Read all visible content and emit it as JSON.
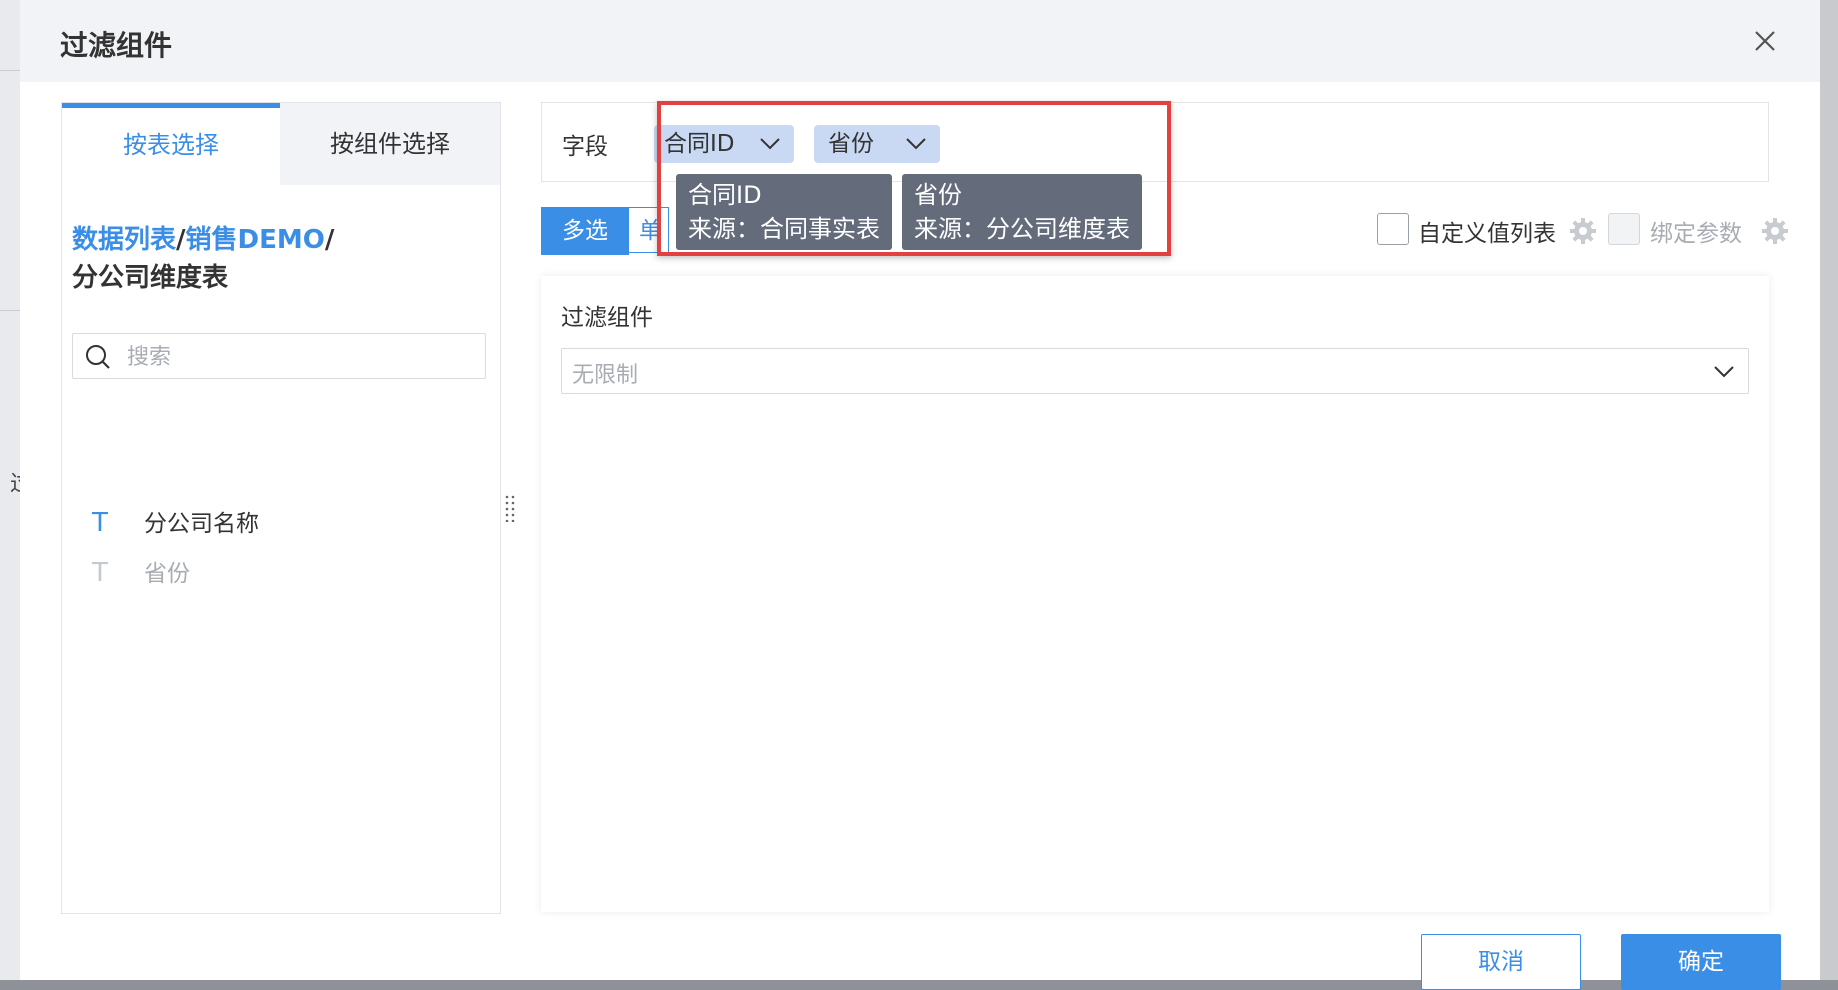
{
  "dialog": {
    "title": "过滤组件"
  },
  "left_panel": {
    "tabs": [
      {
        "label": "按表选择",
        "active": true
      },
      {
        "label": "按组件选择",
        "active": false
      }
    ],
    "breadcrumb": {
      "links": [
        "数据列表",
        "销售DEMO"
      ],
      "separator": "/",
      "current": "分公司维度表"
    },
    "search": {
      "placeholder": "搜索"
    },
    "fields": [
      {
        "type_icon": "T",
        "label": "分公司名称",
        "enabled": true
      },
      {
        "type_icon": "T",
        "label": "省份",
        "enabled": false
      }
    ]
  },
  "field_row": {
    "label": "字段",
    "tags": [
      {
        "label": "合同ID"
      },
      {
        "label": "省份"
      }
    ],
    "tooltips": [
      {
        "name": "合同ID",
        "source": "来源：合同事实表"
      },
      {
        "name": "省份",
        "source": "来源：分公司维度表"
      }
    ]
  },
  "mode": {
    "active": "多选",
    "inactive": "单"
  },
  "options": {
    "custom_value_list": "自定义值列表",
    "bind_params": "绑定参数"
  },
  "config": {
    "title": "过滤组件",
    "select_value": "无限制"
  },
  "footer": {
    "cancel": "取消",
    "ok": "确定"
  },
  "background": {
    "partial_text": "过"
  },
  "colors": {
    "accent": "#3a8ee6",
    "highlight": "#e34040",
    "tooltip_bg": "#646c7c",
    "tag_bg": "#c9d9f3"
  }
}
